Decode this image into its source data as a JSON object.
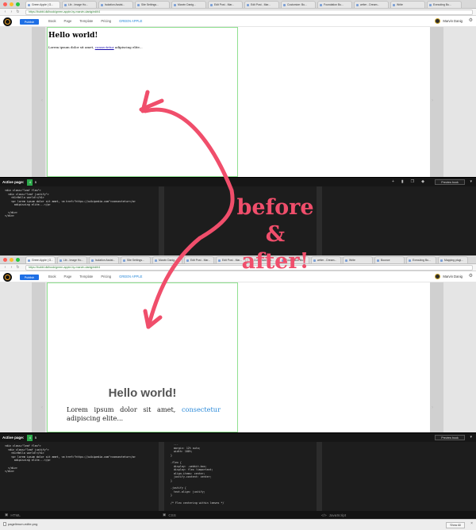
{
  "before": {
    "tabs": [
      "Green Apple | G...",
      "Lib - Image Ho...",
      "Isolation Assist...",
      "Site Settings...",
      "Marvin Danig...",
      "Edit Post - Mar...",
      "Edit Post - Mar...",
      "Customize: Bu...",
      "Foundation Bu...",
      "writer - Dream...",
      "Write",
      "Executing Bu...",
      "Mapping plugi..."
    ],
    "url": "https://bubbl.dk/book/green-apple-by-marvin-danig/edit/4",
    "header": {
      "publish": "Publish",
      "menu": [
        "Book",
        "Page",
        "Template",
        "Pricing",
        "GREEN APPLE"
      ],
      "user": "Marvin Danig"
    },
    "page": {
      "title": "Hello world!",
      "body_before": "Lorem ipsum dolor sit amet, ",
      "link": "consectetur",
      "body_after": " adipiscing elite..."
    },
    "editor": {
      "active_label": "Active page:",
      "pages": [
        "4",
        "5"
      ],
      "preview": "Preview book",
      "html_code": "<div class=\"leaf flex\">\n  <div class=\"leaf justify\">\n    <h1>Hello world!</h1>\n    <p> lorem ipsum dolor sit amet, <a href=\"https://wikipedia.com\">consectetur</a>\n      adipiscing elite...</p>\n\n  </div>\n</div>"
    }
  },
  "after": {
    "tabs": [
      "Green Apple | G...",
      "Lib - Image Ho...",
      "Isolation Assist...",
      "Site Settings...",
      "Marvin Danig...",
      "Edit Post - Mar...",
      "Edit Post - Mar...",
      "Customize: Bu...",
      "Foundation Bu...",
      "writer - Dream...",
      "Write",
      "Bounce",
      "Executing Bu...",
      "Mapping plugi..."
    ],
    "url": "https://bubbl.dk/book/green-apple-by-marvin-danig/edit/4",
    "header": {
      "publish": "Publish",
      "menu": [
        "Book",
        "Page",
        "Template",
        "Pricing",
        "GREEN APPLE"
      ],
      "user": "Marvin Danig"
    },
    "page": {
      "title": "Hello world!",
      "body_before": "Lorem ipsum dolor sit amet, ",
      "link": "consectetur",
      "body_after": " adipiscing elite..."
    },
    "editor": {
      "active_label": "Active page:",
      "pages": [
        "4",
        "5"
      ],
      "preview": "Preview book",
      "html_code": "<div class=\"leaf flex\">\n  <div class=\"leaf justify\">\n    <h1>Hello world!</h1>\n    <p> lorem ipsum dolor sit amet, <a href=\"https://wikipedia.com\">consectetur</a>\n      adipiscing elite...</p>\n\n  </div>\n</div>",
      "css_code": "    ...\n    margin: 12% auto;\n    width: 100%;\n  }\n\n  .flex {\n    display: -webkit-box;\n    display: flex !important;\n    align-items: center;\n    justify-content: center;\n  }\n\n  .justify {\n    text-align: justify;\n  }\n\n  /* Flex centering within leaves */"
    }
  },
  "footer": {
    "html": "HTML",
    "css": "CSS",
    "js": "JavaScript"
  },
  "downloads": {
    "file": "pagelimum-edite.png",
    "show_all": "Show All"
  },
  "annotation": {
    "line1": "before",
    "line2": "& after!"
  },
  "colors": {
    "accent": "#1e6fe5",
    "annotation": "#f04e6b",
    "active_page": "#2ba84a",
    "link": "#2b8ad9"
  }
}
